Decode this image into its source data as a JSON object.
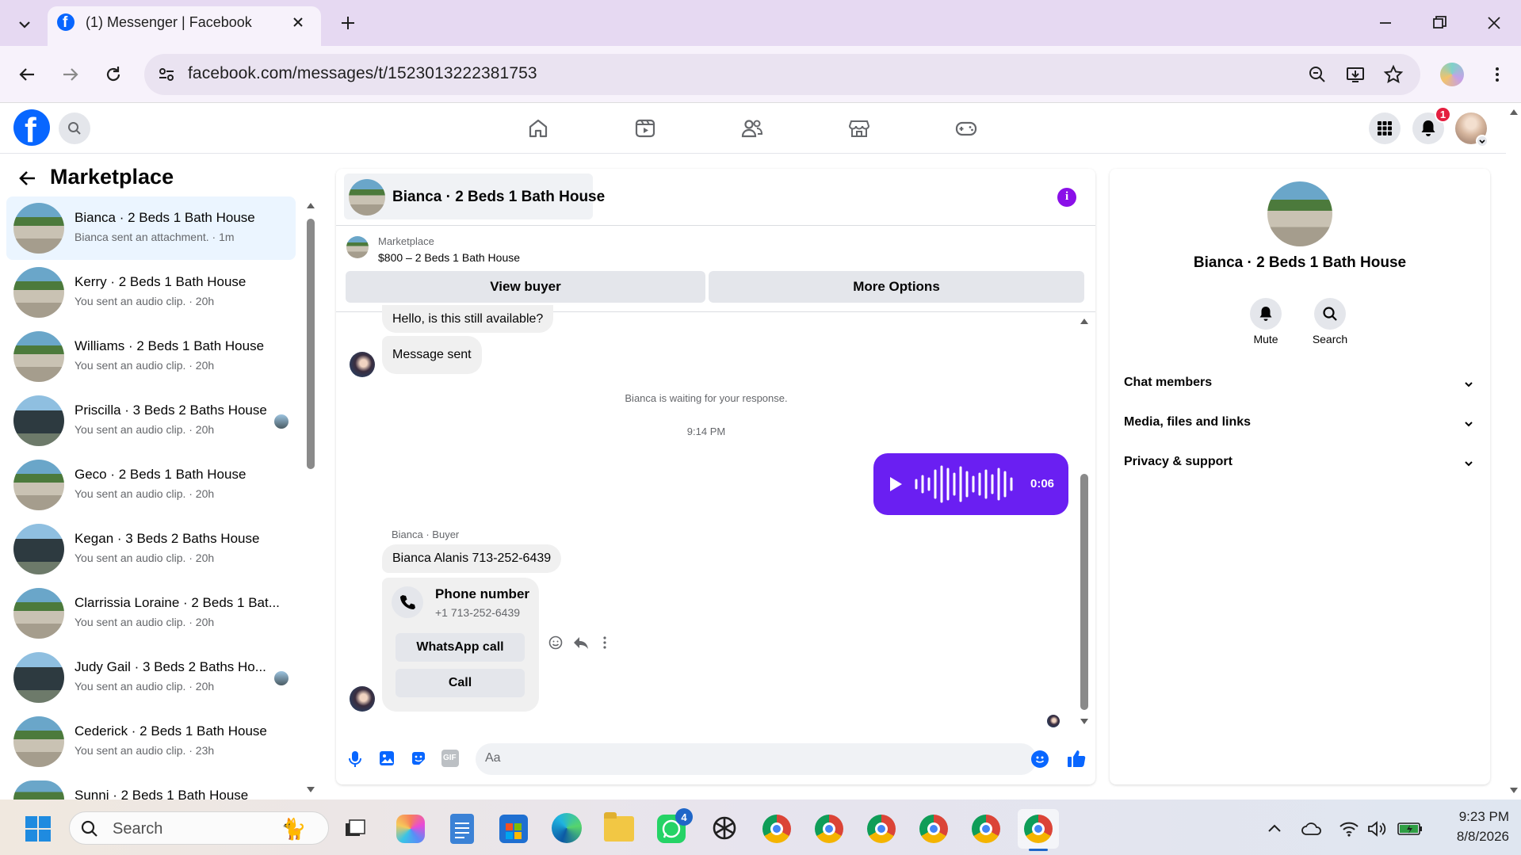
{
  "browser": {
    "tab_title": "(1) Messenger | Facebook",
    "url": "facebook.com/messages/t/1523013222381753"
  },
  "facebook": {
    "notification_count": "1"
  },
  "left_panel": {
    "title": "Marketplace",
    "conversations": [
      {
        "name": "Bianca · 2 Beds 1 Bath House",
        "subtitle": "Bianca sent an attachment. · 1m",
        "active": true
      },
      {
        "name": "Kerry · 2 Beds 1 Bath House",
        "subtitle": "You sent an audio clip. · 20h"
      },
      {
        "name": "Williams · 2 Beds 1 Bath House",
        "subtitle": "You sent an audio clip. · 20h"
      },
      {
        "name": "Priscilla · 3 Beds 2 Baths House",
        "subtitle": "You sent an audio clip. · 20h"
      },
      {
        "name": "Geco · 2 Beds 1 Bath House",
        "subtitle": "You sent an audio clip. · 20h"
      },
      {
        "name": "Kegan · 3 Beds 2 Baths House",
        "subtitle": "You sent an audio clip. · 20h"
      },
      {
        "name": "Clarrissia Loraine · 2 Beds 1 Bat...",
        "subtitle": "You sent an audio clip. · 20h"
      },
      {
        "name": "Judy Gail · 3 Beds 2 Baths Ho...",
        "subtitle": "You sent an audio clip. · 20h"
      },
      {
        "name": "Cederick · 2 Beds 1 Bath House",
        "subtitle": "You sent an audio clip. · 23h"
      },
      {
        "name": "Sunni · 2 Beds 1 Bath House",
        "subtitle": ""
      }
    ]
  },
  "chat": {
    "header_title": "Bianca · 2 Beds 1 Bath House",
    "marketplace_label": "Marketplace",
    "listing": "$800 – 2 Beds 1 Bath House",
    "view_buyer": "View buyer",
    "more_options": "More Options",
    "msg_available": "Hello, is this still available?",
    "msg_sent": "Message sent",
    "waiting_note": "Bianca is waiting for your response.",
    "timestamp": "9:14 PM",
    "audio_duration": "0:06",
    "sender_label": "Bianca · Buyer",
    "msg_phone_text": "Bianca Alanis 713-252-6439",
    "phone_card_title": "Phone number",
    "phone_card_number": "+1 713-252-6439",
    "whatsapp_call": "WhatsApp call",
    "call": "Call",
    "composer_placeholder": "Aa"
  },
  "right_panel": {
    "title": "Bianca · 2 Beds 1 Bath House",
    "mute": "Mute",
    "search": "Search",
    "sections": [
      "Chat members",
      "Media, files and links",
      "Privacy & support"
    ]
  },
  "taskbar": {
    "search_placeholder": "Search",
    "whatsapp_badge": "4",
    "time": "9:23 PM",
    "date": "8/8/2026"
  },
  "colors": {
    "fb_blue": "#0866ff",
    "messenger_purple": "#7a25f0",
    "audio_bubble": "#6a1ff2"
  }
}
